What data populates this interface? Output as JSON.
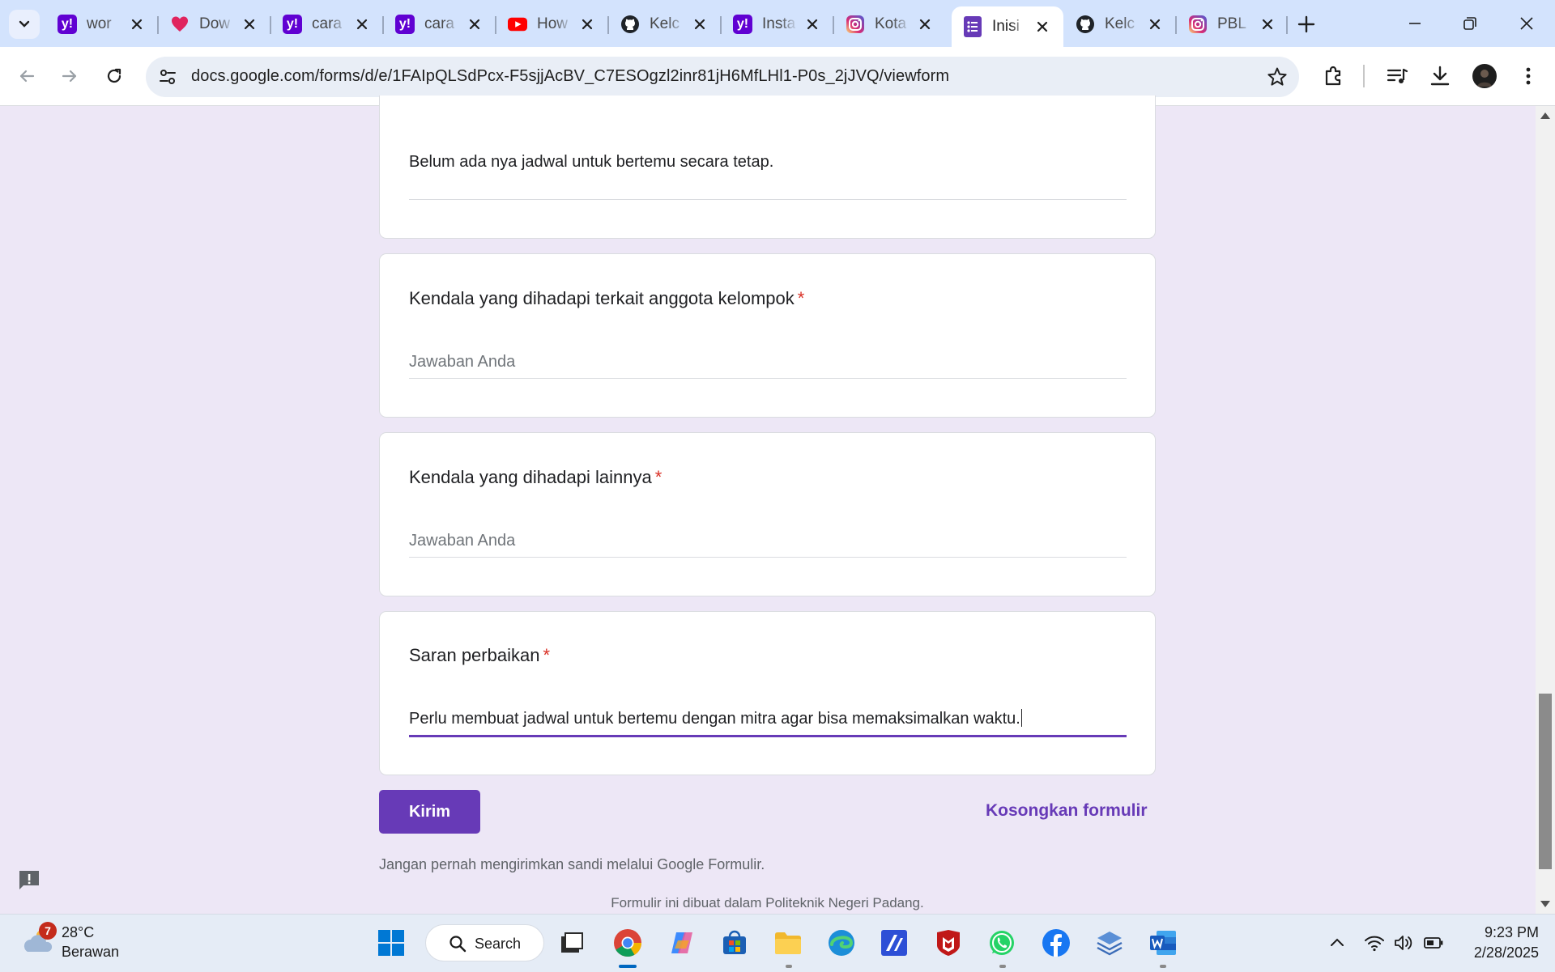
{
  "tabs": [
    {
      "title": "wor",
      "icon": "yahoo-icon",
      "color": "#6001d2"
    },
    {
      "title": "Dow",
      "icon": "heart-icon",
      "color": "#e0245e"
    },
    {
      "title": "cara",
      "icon": "yahoo-icon",
      "color": "#6001d2"
    },
    {
      "title": "cara",
      "icon": "yahoo-icon",
      "color": "#6001d2"
    },
    {
      "title": "How",
      "icon": "youtube-icon",
      "color": "#ff0000"
    },
    {
      "title": "Kelc",
      "icon": "github-icon",
      "color": "#1f2328"
    },
    {
      "title": "Insta",
      "icon": "yahoo-icon",
      "color": "#6001d2"
    },
    {
      "title": "Kota",
      "icon": "instagram-icon",
      "color": "#d6249f"
    },
    {
      "title": "Inisi",
      "icon": "google-forms-icon",
      "color": "#673ab7",
      "active": true
    },
    {
      "title": "Kelc",
      "icon": "github-icon",
      "color": "#1f2328"
    },
    {
      "title": "PBL",
      "icon": "instagram-icon",
      "color": "#d6249f"
    }
  ],
  "omnibox": {
    "url": "docs.google.com/forms/d/e/1FAIpQLSdPcx-F5sjjAcBV_C7ESOgzl2inr81jH6MfLHl1-P0s_2jJVQ/viewform"
  },
  "form": {
    "q1": {
      "answer": "Belum ada nya jadwal untuk bertemu secara tetap."
    },
    "q2": {
      "title": "Kendala yang dihadapi terkait anggota kelompok",
      "required_mark": "*",
      "placeholder": "Jawaban Anda"
    },
    "q3": {
      "title": "Kendala yang dihadapi lainnya",
      "required_mark": "*",
      "placeholder": "Jawaban Anda"
    },
    "q4": {
      "title": "Saran perbaikan",
      "required_mark": "*",
      "answer": "Perlu membuat jadwal untuk bertemu dengan mitra agar bisa memaksimalkan waktu."
    },
    "submit_label": "Kirim",
    "clear_label": "Kosongkan formulir",
    "password_warning": "Jangan pernah mengirimkan sandi melalui Google Formulir.",
    "footer": "Formulir ini dibuat dalam Politeknik Negeri Padang.",
    "accent_color": "#673ab7",
    "required_color": "#d93025"
  },
  "taskbar": {
    "weather": {
      "temp": "28°C",
      "condition": "Berawan",
      "badge": "7"
    },
    "search_label": "Search",
    "apps": [
      "task-view",
      "chrome",
      "copilot",
      "microsoft-store",
      "file-explorer",
      "edge",
      "app",
      "mcafee",
      "whatsapp",
      "facebook",
      "network-app",
      "word"
    ],
    "clock": {
      "time": "9:23 PM",
      "date": "2/28/2025"
    }
  }
}
